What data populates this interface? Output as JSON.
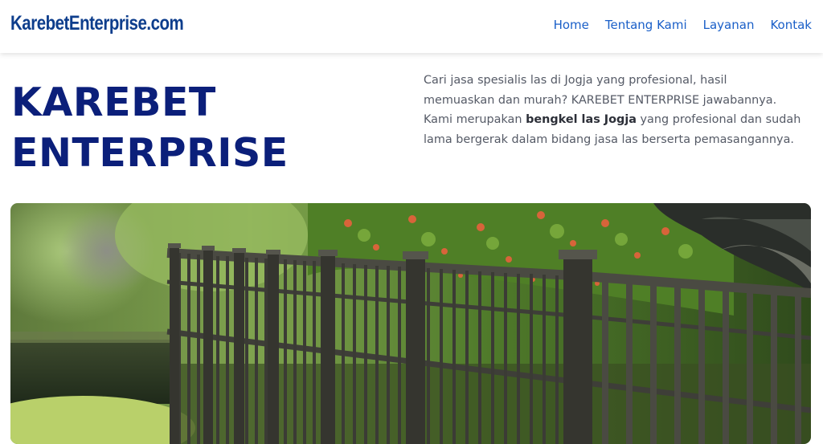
{
  "header": {
    "logo_text": "KarebetEnterprise.com",
    "nav": [
      {
        "label": "Home"
      },
      {
        "label": "Tentang Kami"
      },
      {
        "label": "Layanan"
      },
      {
        "label": "Kontak"
      }
    ]
  },
  "hero": {
    "title_line1": "KAREBET",
    "title_line2": "ENTERPRISE",
    "desc_before": "Cari jasa spesialis las di Jogja yang profesional, hasil memuaskan dan murah? KAREBET ENTERPRISE jawabannya. Kami merupakan ",
    "desc_bold": "bengkel las Jogja",
    "desc_after": " yang profesional dan sudah lama bergerak dalam bidang jasa las berserta pemasangannya."
  },
  "colors": {
    "brand_blue": "#0d3d8c",
    "title_navy": "#0b1f7a",
    "nav_link": "#1a5fc8",
    "body_text": "#555a66"
  },
  "icons": {
    "hero_photo": "metal-fence-garden-photo"
  }
}
